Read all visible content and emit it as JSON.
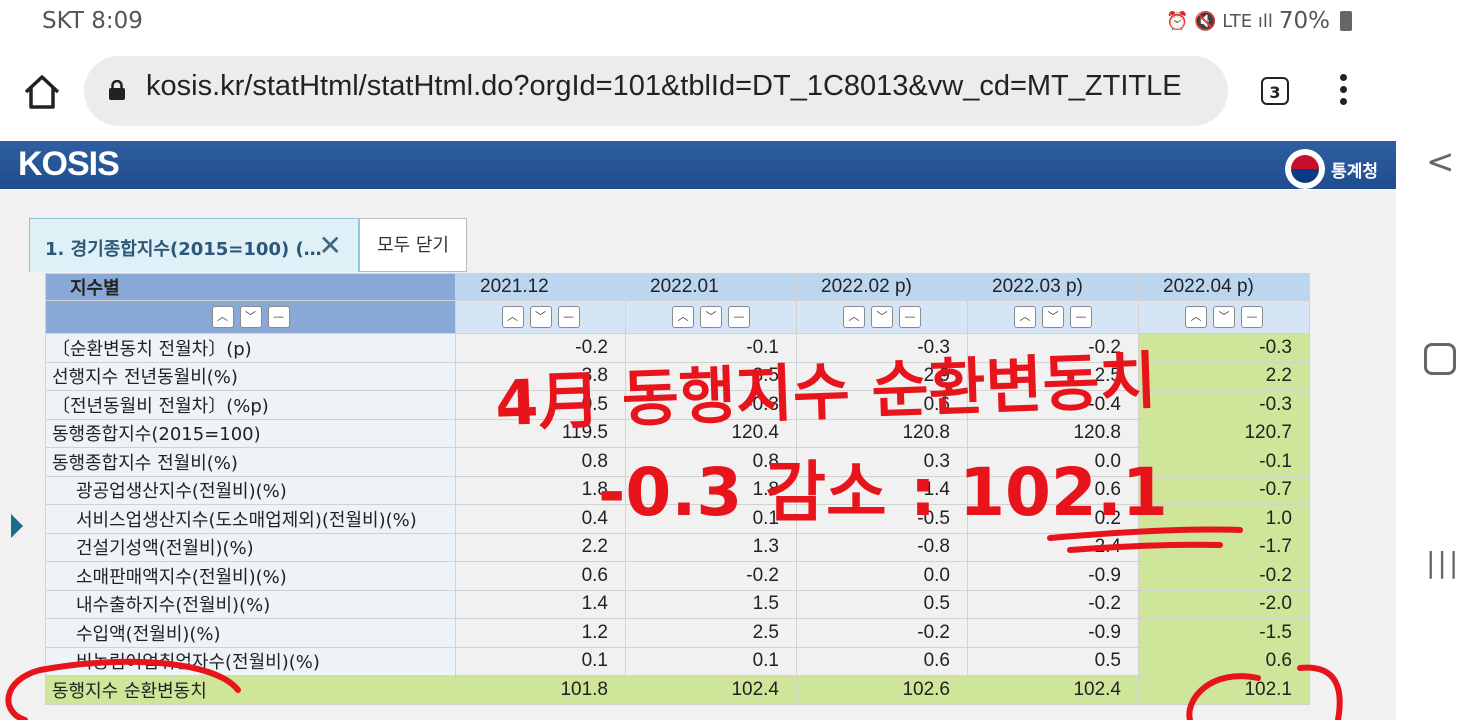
{
  "status": {
    "carrier_time": "SKT 8:09",
    "icons": "⏰ 🔇 LTE ıll",
    "battery": "70%"
  },
  "browser": {
    "url": "kosis.kr/statHtml/statHtml.do?orgId=101&tblId=DT_1C8013&vw_cd=MT_ZTITLE",
    "tab_count": "3"
  },
  "header": {
    "logo": "KOSIS",
    "agency": "통계청"
  },
  "tabs": {
    "active_label": "1. 경기종합지수(2015=100) (…",
    "close_all": "모두 닫기"
  },
  "table": {
    "corner_label": "지수별",
    "columns": [
      "2021.12",
      "2022.01",
      "2022.02 p)",
      "2022.03 p)",
      "2022.04 p)"
    ],
    "rows": [
      {
        "name": "〔순환변동치 전월차〕(p)",
        "values": [
          "-0.2",
          "-0.1",
          "-0.3",
          "-0.2",
          "-0.3"
        ]
      },
      {
        "name": "선행지수 전년동월비(%)",
        "values": [
          "3.8",
          "3.5",
          "2.9",
          "2.5",
          "2.2"
        ]
      },
      {
        "name": "〔전년동월비 전월차〕(%p)",
        "values": [
          "-0.5",
          "-0.3",
          "0.6",
          "-0.4",
          "-0.3"
        ]
      },
      {
        "name": "동행종합지수(2015=100)",
        "values": [
          "119.5",
          "120.4",
          "120.8",
          "120.8",
          "120.7"
        ]
      },
      {
        "name": "동행종합지수 전월비(%)",
        "values": [
          "0.8",
          "0.8",
          "0.3",
          "0.0",
          "-0.1"
        ]
      },
      {
        "name": "광공업생산지수(전월비)(%)",
        "values": [
          "1.8",
          "1.8",
          "1.4",
          "0.6",
          "-0.7"
        ]
      },
      {
        "name": "서비스업생산지수(도소매업제외)(전월비)(%)",
        "values": [
          "0.4",
          "0.1",
          "-0.5",
          "0.2",
          "1.0"
        ]
      },
      {
        "name": "건설기성액(전월비)(%)",
        "values": [
          "2.2",
          "1.3",
          "-0.8",
          "-2.4",
          "-1.7"
        ]
      },
      {
        "name": "소매판매액지수(전월비)(%)",
        "values": [
          "0.6",
          "-0.2",
          "0.0",
          "-0.9",
          "-0.2"
        ]
      },
      {
        "name": "내수출하지수(전월비)(%)",
        "values": [
          "1.4",
          "1.5",
          "0.5",
          "-0.2",
          "-2.0"
        ]
      },
      {
        "name": "수입액(전월비)(%)",
        "values": [
          "1.2",
          "2.5",
          "-0.2",
          "-0.9",
          "-1.5"
        ]
      },
      {
        "name": "비농림어업취업자수(전월비)(%)",
        "values": [
          "0.1",
          "0.1",
          "0.6",
          "0.5",
          "0.6"
        ]
      },
      {
        "name": "동행지수 순환변동치",
        "values": [
          "101.8",
          "102.4",
          "102.6",
          "102.4",
          "102.1"
        ]
      }
    ]
  },
  "annotation": {
    "line1": "4月 동행지수 순환변동치",
    "line2": "-0.3 감소 : 102.1"
  },
  "colors": {
    "header_blue": "#1f4c8e",
    "highlight_green": "#cfe59a",
    "ink_red": "#e8141b"
  }
}
